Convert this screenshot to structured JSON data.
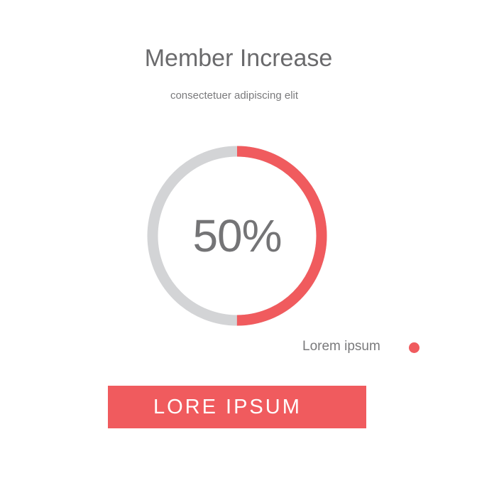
{
  "header": {
    "title": "Member Increase",
    "subtitle": "consectetuer adipiscing elit"
  },
  "progress": {
    "value_label": "50%",
    "value": 0.5
  },
  "legend": {
    "label": "Lorem ipsum"
  },
  "cta": {
    "label": "LORE IPSUM"
  },
  "colors": {
    "accent": "#f05b5e",
    "track": "#d3d4d6",
    "text": "#6f6f71"
  }
}
